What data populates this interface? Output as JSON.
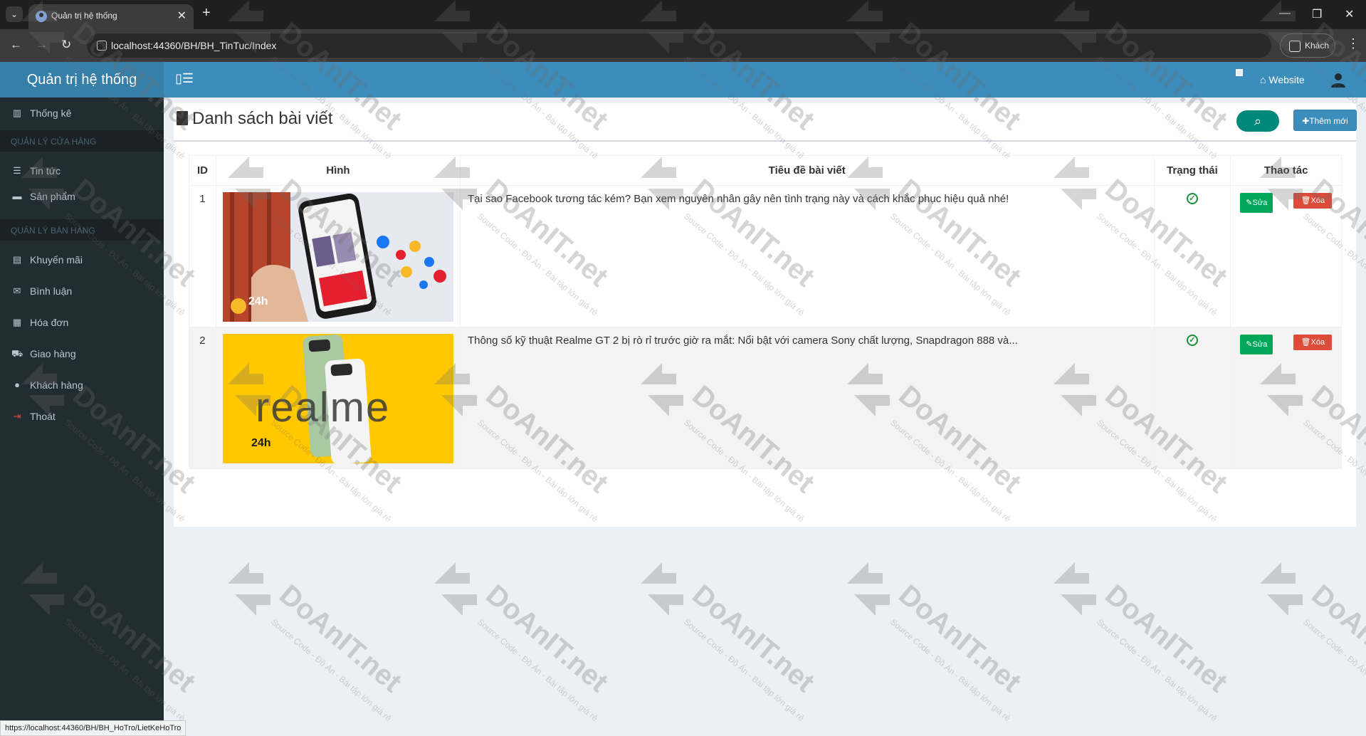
{
  "browser": {
    "tab_title": "Quản trị hệ thống",
    "tab_close": "✕",
    "new_tab": "+",
    "url": "localhost:44360/BH/BH_TinTuc/Index",
    "profile": "Khách",
    "status_url": "https://localhost:44360/BH/BH_HoTro/LietKeHoTro",
    "minimize": "—",
    "maximize": "❐",
    "close": "✕"
  },
  "header": {
    "logo": "Quản trị hệ thống",
    "website_label": "Website"
  },
  "sidebar": {
    "items": [
      {
        "label": "Thống kê",
        "icon": "bar-chart-icon"
      },
      {
        "label": "QUẢN LÝ CỬA HÀNG",
        "type": "header"
      },
      {
        "label": "Tin tức",
        "icon": "list-icon"
      },
      {
        "label": "Sản phẩm",
        "icon": "briefcase-icon"
      },
      {
        "label": "QUẢN LÝ BÁN HÀNG",
        "type": "header"
      },
      {
        "label": "Khuyến mãi",
        "icon": "credit-card-icon"
      },
      {
        "label": "Bình luận",
        "icon": "envelope-icon"
      },
      {
        "label": "Hóa đơn",
        "icon": "calendar-check-icon"
      },
      {
        "label": "Giao hàng",
        "icon": "truck-icon"
      },
      {
        "label": "Khách hàng",
        "icon": "user-icon"
      },
      {
        "label": "Thoát",
        "icon": "sign-out-icon"
      }
    ]
  },
  "main": {
    "title": "Danh sách bài viết",
    "add_button": "Thêm mới",
    "columns": [
      "ID",
      "Hình",
      "Tiêu đề bài viết",
      "Trạng thái",
      "Thao tác"
    ],
    "rows": [
      {
        "id": "1",
        "title": "Tại sao Facebook tương tác kém? Bạn xem nguyên nhân gây nên tình trạng này và cách khắc phục hiệu quả nhé!",
        "thumb_badge": "24h",
        "edit": "Sửa",
        "delete": "Xóa"
      },
      {
        "id": "2",
        "title": "Thông số kỹ thuật Realme GT 2 bị rò rỉ trước giờ ra mắt: Nổi bật với camera Sony chất lượng, Snapdragon 888 và...",
        "thumb_badge": "24h",
        "thumb_text": "realme",
        "edit": "Sửa",
        "delete": "Xóa"
      }
    ]
  },
  "watermark": {
    "brand": "DoAnIT.net",
    "tagline": "Source Code - Đồ Án - Bài tập lớn giá rẻ"
  },
  "colors": {
    "header": "#3c8dbc",
    "sidebar": "#222d32",
    "success": "#00a65a",
    "danger": "#dd4b39",
    "search": "#00897b"
  }
}
